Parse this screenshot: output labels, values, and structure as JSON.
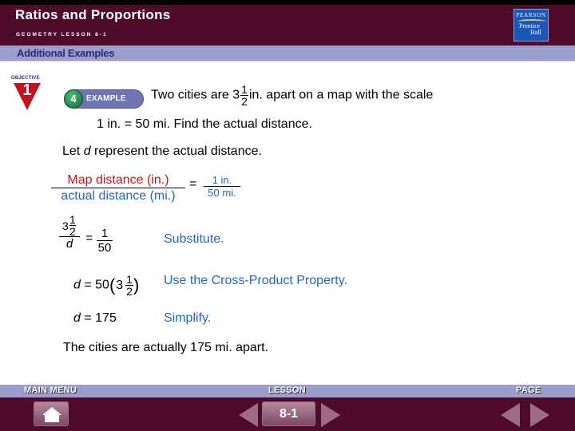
{
  "header": {
    "title": "Ratios and Proportions",
    "subtitle": "GEOMETRY LESSON 8-1",
    "section": "Additional Examples",
    "logo": {
      "top": "PEARSON",
      "line1": "Prentice",
      "line2": "Hall"
    }
  },
  "objective": {
    "label": "OBJECTIVE",
    "number": "1"
  },
  "example": {
    "number": "4",
    "label": "EXAMPLE"
  },
  "problem": {
    "part1": "Two cities are 3",
    "frac_num": "1",
    "frac_den": "2",
    "part2": "in. apart on a map with the scale",
    "line2": "1 in. = 50 mi. Find the actual distance."
  },
  "solution": {
    "let_prefix": "Let ",
    "let_var": "d",
    "let_suffix": " represent the actual distance.",
    "ratio": {
      "left_num": "Map distance (in.)",
      "left_den": "actual distance (mi.)",
      "equals": "=",
      "right_num": "1 in.",
      "right_den": "50 mi."
    },
    "step1": {
      "whole": "3",
      "mixed_num": "1",
      "mixed_den": "2",
      "den": "d",
      "equals": "=",
      "right_num": "1",
      "right_den": "50",
      "note": "Substitute."
    },
    "step2": {
      "lhs": "d",
      "expr": " = 50",
      "open": "(",
      "whole": "3",
      "num": "1",
      "den": "2",
      "close": ")",
      "note": "Use the Cross-Product Property."
    },
    "step3": {
      "lhs": "d",
      "expr": " = 175",
      "note": "Simplify."
    },
    "conclusion": "The cities are actually 175 mi. apart."
  },
  "footer": {
    "main_menu": "MAIN MENU",
    "lesson": "LESSON",
    "lesson_value": "8-1",
    "page": "PAGE"
  },
  "colors": {
    "header_bg": "#4e0b2a",
    "band_bg": "#9b9dcc",
    "red_text": "#c4161c",
    "blue_text": "#2166c0"
  }
}
